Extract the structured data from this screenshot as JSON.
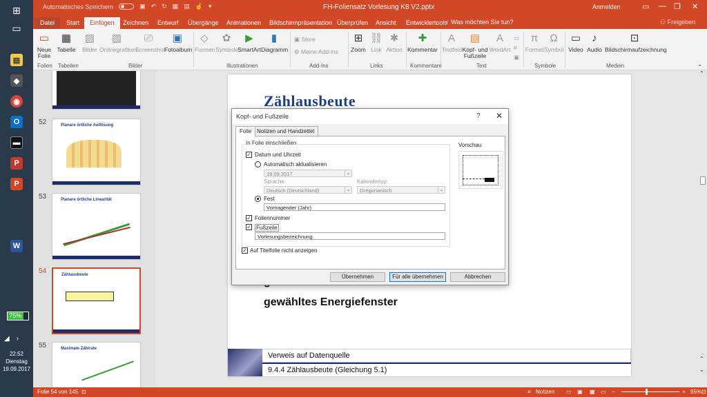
{
  "titlebar": {
    "autosave_label": "Automatisches Speichern",
    "doc_title": "FH-Foliensatz Vorlesung K8 V2.pptx",
    "signin": "Anmelden"
  },
  "tabs": [
    "Datei",
    "Start",
    "Einfügen",
    "Zeichnen",
    "Entwurf",
    "Übergänge",
    "Animationen",
    "Bildschirmpräsentation",
    "Überprüfen",
    "Ansicht",
    "Entwicklertools"
  ],
  "active_tab": "Einfügen",
  "tellme": "Was möchten Sie tun?",
  "share": "Freigeben",
  "ribbon": {
    "neue_folie": "Neue Folie",
    "tabelle": "Tabelle",
    "bilder": "Bilder",
    "onlinegrafiken": "Onlinegrafiken",
    "screenshot": "Screenshot",
    "fotoalbum": "Fotoalbum",
    "formen": "Formen",
    "symbole": "Symbole",
    "smartart": "SmartArt",
    "diagramm": "Diagramm",
    "store": "Store",
    "meine_addins": "Meine Add-ins",
    "zoom": "Zoom",
    "link": "Link",
    "aktion": "Aktion",
    "kommentar": "Kommentar",
    "textfeld": "Textfeld",
    "kopf_fuss": "Kopf- und Fußzeile",
    "wordart": "WordArt",
    "formel": "Formel",
    "symbol": "Symbol",
    "video": "Video",
    "audio": "Audio",
    "bildschirmaufzeichnung": "Bildschirmaufzeichnung",
    "groups": {
      "folien": "Folien",
      "tabellen": "Tabellen",
      "bilder": "Bilder",
      "illustrationen": "Illustrationen",
      "addins": "Add-Ins",
      "links": "Links",
      "kommentare": "Kommentare",
      "text": "Text",
      "symbole": "Symbole",
      "medien": "Medien"
    }
  },
  "thumbnails": [
    {
      "num": "52",
      "title": "Planare örtliche Auflösung"
    },
    {
      "num": "53",
      "title": "Planare örtliche Linearität"
    },
    {
      "num": "54",
      "title": "Zählausbeute"
    },
    {
      "num": "55",
      "title": "Maximale Zählrate"
    }
  ],
  "slide": {
    "title": "Zählausbeute",
    "line1": "gewähltes Nuklid",
    "line2": "gewähltes Energiefenster",
    "footer1": "Verweis auf Datenquelle",
    "footer2": "9.4.4 Zählausbeute (Gleichung 5.1)"
  },
  "dialog": {
    "title": "Kopf- und Fußzeile",
    "help": "?",
    "close": "✕",
    "tab_folie": "Folie",
    "tab_notizen": "Notizen und Handzettel",
    "group_label": "In Folie einschließen",
    "datum_label": "Datum und Uhrzeit",
    "datum_checked": true,
    "auto_label": "Automatisch aktualisieren",
    "auto_value": "19.09.2017",
    "sprache_label": "Sprache:",
    "sprache_value": "Deutsch (Deutschland)",
    "kalender_label": "Kalendertyp:",
    "kalender_value": "Gregorianisch",
    "fest_label": "Fest",
    "fest_value": "Vortragender (Jahr)",
    "foliennummer_label": "Foliennummer",
    "foliennummer_checked": true,
    "fusszeile_label": "Fußzeile",
    "fusszeile_checked": true,
    "fusszeile_value": "Vorlesungsbezeichnung",
    "titelfolie_label": "Auf Titelfolie nicht anzeigen",
    "titelfolie_checked": true,
    "vorschau_label": "Vorschau",
    "btn_uebernehmen": "Übernehmen",
    "btn_alle": "Für alle übernehmen",
    "btn_abbrechen": "Abbrechen"
  },
  "statusbar": {
    "slide_info": "Folie 54 von 145",
    "notizen": "Notizen",
    "zoom": "95%"
  },
  "taskbar": {
    "battery": "75%",
    "time": "22:52",
    "day": "Dienstag",
    "date": "19.09.2017"
  },
  "colors": {
    "accent": "#d24726",
    "slide_title": "#1d3f8a"
  }
}
